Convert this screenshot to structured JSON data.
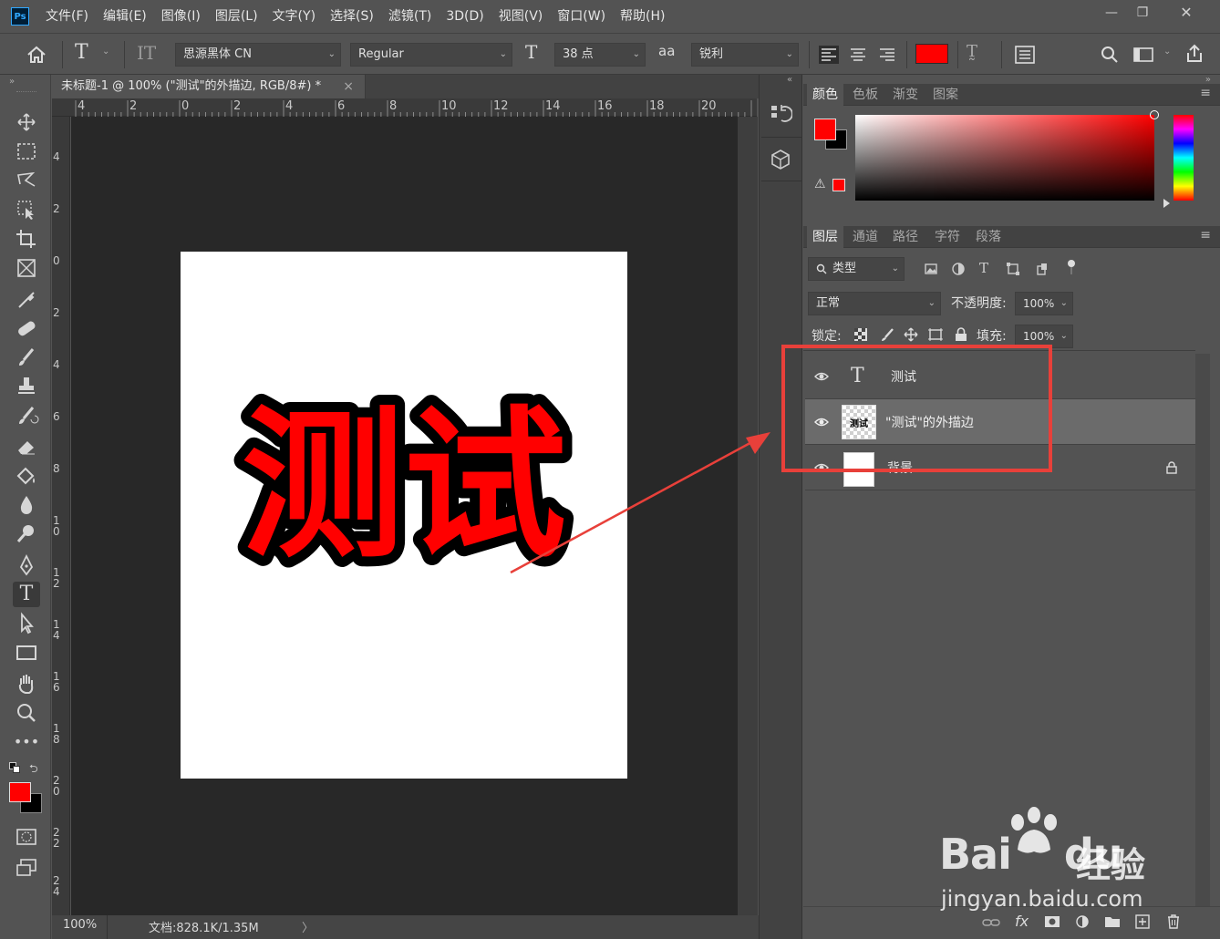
{
  "app": {
    "logo": "Ps"
  },
  "menu": [
    "文件(F)",
    "编辑(E)",
    "图像(I)",
    "图层(L)",
    "文字(Y)",
    "选择(S)",
    "滤镜(T)",
    "3D(D)",
    "视图(V)",
    "窗口(W)",
    "帮助(H)"
  ],
  "window_controls": {
    "minimize": "—",
    "restore": "❐",
    "close": "✕"
  },
  "options": {
    "font_family": "思源黑体 CN",
    "font_style": "Regular",
    "font_size": "38 点",
    "antialias_icon": "aa",
    "antialias": "锐利",
    "text_color": "#ff0000"
  },
  "document": {
    "tab_title": "未标题-1 @ 100% (\"测试\"的外描边, RGB/8#) *",
    "tab_close": "×",
    "ruler_top": [
      "4",
      "2",
      "0",
      "2",
      "4",
      "6",
      "8",
      "10",
      "12",
      "14",
      "16",
      "18",
      "20"
    ],
    "ruler_left": [
      "4",
      "2",
      "0",
      "2",
      "4",
      "6",
      "8",
      "10",
      "12",
      "14",
      "16",
      "18",
      "20",
      "22",
      "24"
    ],
    "canvas_text": "测试",
    "zoom": "100%",
    "doc_info": "文档:828.1K/1.35M",
    "status_arrow": "〉"
  },
  "color_panel": {
    "tabs": [
      "颜色",
      "色板",
      "渐变",
      "图案"
    ],
    "foreground": "#ff0000",
    "background": "#000000"
  },
  "layers_panel": {
    "tabs": [
      "图层",
      "通道",
      "路径",
      "字符",
      "段落"
    ],
    "filter_kind": "类型",
    "blend_mode": "正常",
    "opacity_label": "不透明度:",
    "opacity": "100%",
    "lock_label": "锁定:",
    "fill_label": "填充:",
    "fill": "100%",
    "layers": [
      {
        "name": "测试",
        "type": "text",
        "visible": true
      },
      {
        "name": "\"测试\"的外描边",
        "type": "pixel",
        "visible": true,
        "selected": true,
        "thumb_text": "测试"
      },
      {
        "name": "背景",
        "type": "background",
        "visible": true,
        "locked": true
      }
    ],
    "footer_icons": [
      "link-icon",
      "fx-icon",
      "mask-icon",
      "adjustment-icon",
      "group-icon",
      "new-layer-icon",
      "trash-icon"
    ],
    "fx_label": "fx"
  },
  "annotation": {
    "color": "#e8403a"
  },
  "watermark": {
    "brand": "Bai",
    "brand_du": "du",
    "suffix": "经验",
    "url": "jingyan.baidu.com"
  }
}
